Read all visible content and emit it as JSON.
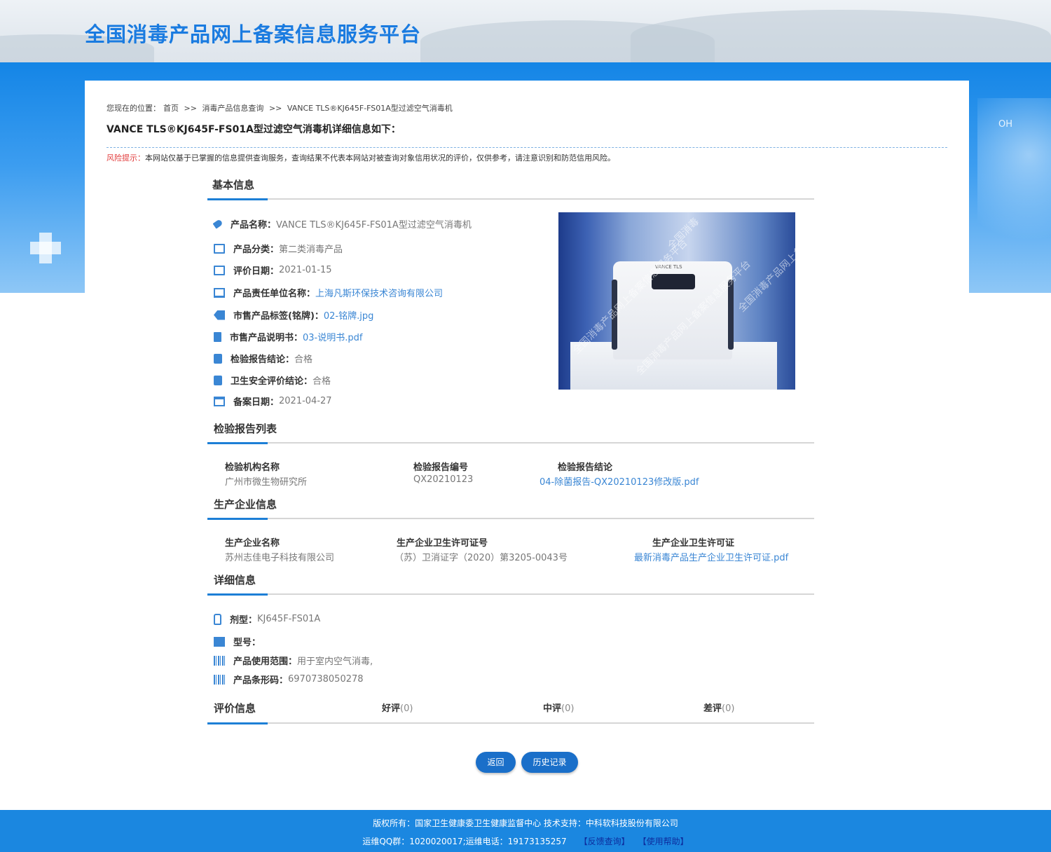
{
  "site": {
    "title": "全国消毒产品网上备案信息服务平台"
  },
  "breadcrumb": {
    "prefix": "您现在的位置：",
    "home": "首页",
    "sep1": ">>",
    "query": "消毒产品信息查询",
    "sep2": ">>",
    "current": "VANCE TLS®KJ645F-FS01A型过滤空气消毒机"
  },
  "detail_heading": "VANCE TLS®KJ645F-FS01A型过滤空气消毒机详细信息如下：",
  "risk": {
    "label": "风险提示：",
    "text": "本网站仅基于已掌握的信息提供查询服务，查询结果不代表本网站对被查询对象信用状况的评价，仅供参考，请注意识别和防范信用风险。"
  },
  "basic": {
    "title": "基本信息",
    "product_name": {
      "label": "产品名称：",
      "value": "VANCE TLS®KJ645F-FS01A型过滤空气消毒机"
    },
    "category": {
      "label": "产品分类：",
      "value": "第二类消毒产品"
    },
    "eval_date": {
      "label": "评价日期：",
      "value": "2021-01-15"
    },
    "company": {
      "label": "产品责任单位名称：",
      "value": "上海凡斯环保技术咨询有限公司"
    },
    "nameplate": {
      "label": "市售产品标签(铭牌)：",
      "value": "02-铭牌.jpg"
    },
    "manual": {
      "label": "市售产品说明书：",
      "value": "03-说明书.pdf"
    },
    "inspection": {
      "label": "检验报告结论：",
      "value": "合格"
    },
    "safety": {
      "label": "卫生安全评价结论：",
      "value": "合格"
    },
    "record_date": {
      "label": "备案日期：",
      "value": "2021-04-27"
    }
  },
  "photo": {
    "device_brand": "VANCE TLS",
    "watermarks": [
      "全国消毒产品网上备案信息服务平台",
      "全国消毒产品网上备案信息服务平台",
      "全国消毒",
      "全国消毒产品网上备案信息服务"
    ]
  },
  "reports": {
    "title": "检验报告列表",
    "headers": [
      "检验机构名称",
      "检验报告编号",
      "检验报告结论"
    ],
    "row": [
      "广州市微生物研究所",
      "QX20210123",
      "04-除菌报告-QX20210123修改版.pdf"
    ]
  },
  "manufacturer": {
    "title": "生产企业信息",
    "headers": [
      "生产企业名称",
      "生产企业卫生许可证号",
      "生产企业卫生许可证"
    ],
    "row": [
      "苏州志佳电子科技有限公司",
      "（苏）卫消证字（2020）第3205-0043号",
      "最新消毒产品生产企业卫生许可证.pdf"
    ]
  },
  "details": {
    "title": "详细信息",
    "form": {
      "label": "剂型：",
      "value": "KJ645F-FS01A"
    },
    "model": {
      "label": "型号：",
      "value": ""
    },
    "scope": {
      "label": "产品使用范围：",
      "value": "用于室内空气消毒,"
    },
    "barcode": {
      "label": "产品条形码：",
      "value": "6970738050278"
    }
  },
  "evaluation": {
    "title": "评价信息",
    "good": {
      "label": "好评",
      "count": "(0)"
    },
    "medium": {
      "label": "中评",
      "count": "(0)"
    },
    "bad": {
      "label": "差评",
      "count": "(0)"
    }
  },
  "buttons": {
    "back": "返回",
    "history": "历史记录"
  },
  "footer": {
    "line1": "版权所有：国家卫生健康委卫生健康监督中心  技术支持：中科软科技股份有限公司",
    "line2": "运维QQ群：1020020017;运维电话：19173135257",
    "feedback": "【反馈查询】",
    "help": "【使用帮助】"
  },
  "colors": {
    "brand": "#1a7be0",
    "link": "#3a86d4",
    "risk": "#e23b3b",
    "footer": "#1b87e0",
    "button": "#1a6fc9"
  }
}
